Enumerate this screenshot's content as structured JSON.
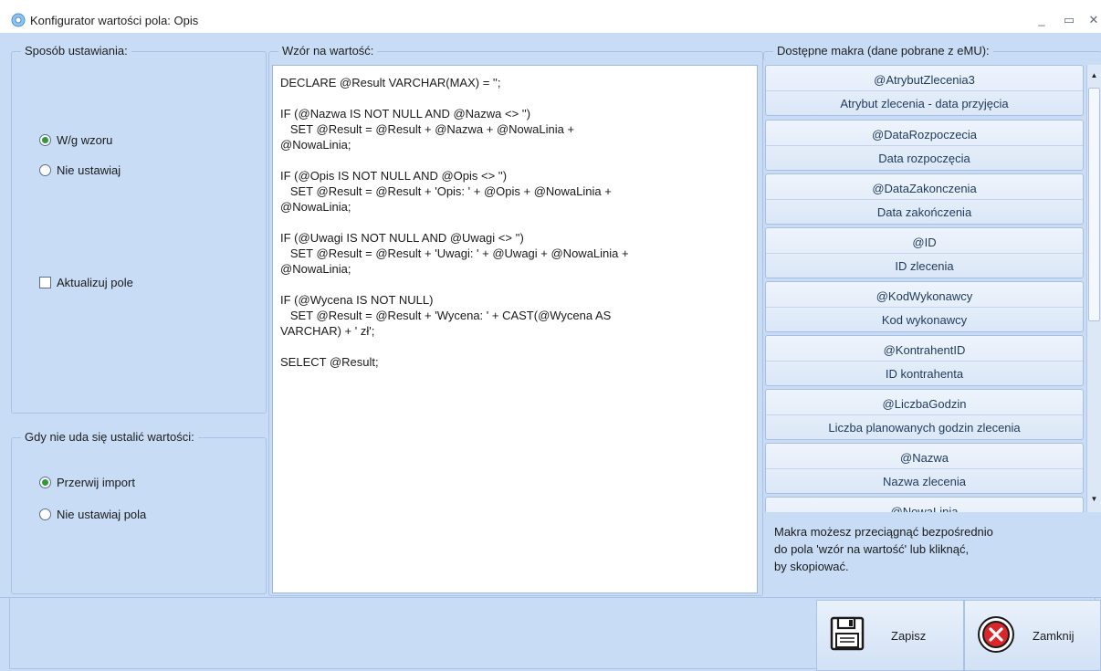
{
  "window": {
    "title": "Konfigurator wartości pola: Opis",
    "minimize_glyph": "_",
    "maximize_glyph": "▭",
    "close_glyph": "✕"
  },
  "method_group": {
    "legend": "Sposób ustawiania:",
    "options": [
      {
        "label": "W/g wzoru",
        "selected": true
      },
      {
        "label": "Nie ustawiaj",
        "selected": false
      }
    ],
    "update_checkbox": {
      "label": "Aktualizuj pole",
      "checked": false
    }
  },
  "fallback_group": {
    "legend": "Gdy nie uda się ustalić wartości:",
    "options": [
      {
        "label": "Przerwij import",
        "selected": true
      },
      {
        "label": "Nie ustawiaj pola",
        "selected": false
      }
    ]
  },
  "pattern": {
    "legend": "Wzór na wartość:",
    "code": "DECLARE @Result VARCHAR(MAX) = '';\n\nIF (@Nazwa IS NOT NULL AND @Nazwa <> '')\n   SET @Result = @Result + @Nazwa + @NowaLinia +\n@NowaLinia;\n\nIF (@Opis IS NOT NULL AND @Opis <> '')\n   SET @Result = @Result + 'Opis: ' + @Opis + @NowaLinia +\n@NowaLinia;\n\nIF (@Uwagi IS NOT NULL AND @Uwagi <> '')\n   SET @Result = @Result + 'Uwagi: ' + @Uwagi + @NowaLinia +\n@NowaLinia;\n\nIF (@Wycena IS NOT NULL)\n   SET @Result = @Result + 'Wycena: ' + CAST(@Wycena AS\nVARCHAR) + ' zł';\n\nSELECT @Result;"
  },
  "macros": {
    "legend": "Dostępne makra (dane pobrane z eMU):",
    "items": [
      {
        "name": "@AtrybutZlecenia3",
        "desc": "Atrybut zlecenia - data przyjęcia"
      },
      {
        "name": "@DataRozpoczecia",
        "desc": "Data rozpoczęcia"
      },
      {
        "name": "@DataZakonczenia",
        "desc": "Data zakończenia"
      },
      {
        "name": "@ID",
        "desc": "ID zlecenia"
      },
      {
        "name": "@KodWykonawcy",
        "desc": "Kod wykonawcy"
      },
      {
        "name": "@KontrahentID",
        "desc": "ID kontrahenta"
      },
      {
        "name": "@LiczbaGodzin",
        "desc": "Liczba planowanych godzin zlecenia"
      },
      {
        "name": "@Nazwa",
        "desc": "Nazwa zlecenia"
      },
      {
        "name": "@NowaLinia",
        "desc": ""
      }
    ],
    "hint": "Makra możesz przeciągnąć bezpośrednio\ndo pola 'wzór na wartość' lub kliknąć,\nby skopiować."
  },
  "footer": {
    "save_label": "Zapisz",
    "close_label": "Zamknij"
  },
  "colors": {
    "panel_bg": "#c9dcf6",
    "border": "#a9c2e6",
    "radio_selected": "#2f9a3a",
    "close_icon": "#d8262b"
  }
}
